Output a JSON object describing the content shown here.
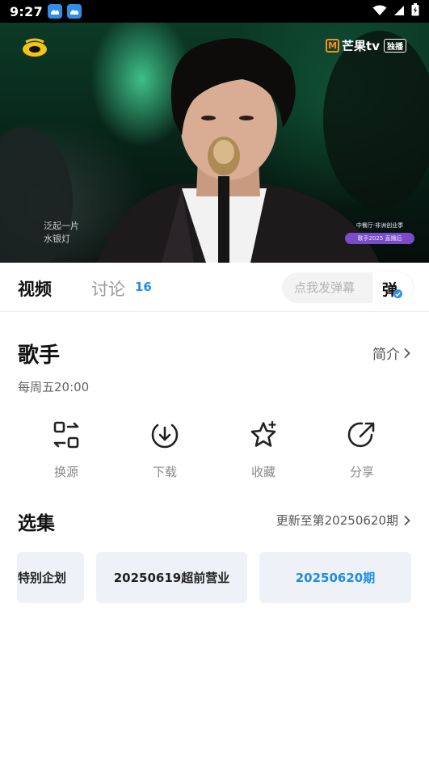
{
  "status_bar": {
    "time": "9:27",
    "icons": [
      "app-notification-icon",
      "app-notification-icon",
      "wifi-icon",
      "signal-icon",
      "battery-icon"
    ]
  },
  "video": {
    "channel_logo": "hunan-tv-logo",
    "platform_logo": {
      "text": "芒果tv",
      "badge": "独播"
    },
    "lyric_lines": [
      "泛起一片",
      "水银灯"
    ],
    "badge_top": "中餐厅·非洲创业季",
    "badge_bottom": "歌手2025 直播后"
  },
  "tabs": {
    "video": "视频",
    "discuss": "讨论",
    "discuss_count": "16"
  },
  "danmu": {
    "placeholder": "点我发弹幕",
    "toggle_label": "弹",
    "accent": "#2e90e6"
  },
  "show": {
    "title": "歌手",
    "intro_label": "简介",
    "schedule": "每周五20:00"
  },
  "actions": [
    {
      "label": "换源",
      "icon": "switch-source-icon"
    },
    {
      "label": "下载",
      "icon": "download-icon"
    },
    {
      "label": "收藏",
      "icon": "star-icon"
    },
    {
      "label": "分享",
      "icon": "share-icon"
    }
  ],
  "episodes": {
    "title": "选集",
    "more_label": "更新至第20250620期",
    "items": [
      {
        "label": "特别企划",
        "active": false
      },
      {
        "label": "20250619超前营业",
        "active": false
      },
      {
        "label": "20250620期",
        "active": true
      }
    ],
    "active_color": "#1f8de0"
  }
}
